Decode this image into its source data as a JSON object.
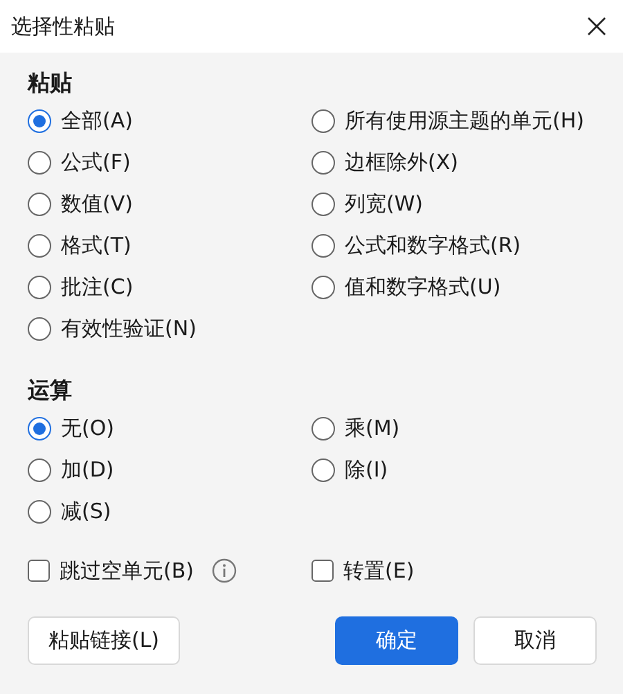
{
  "window": {
    "title": "选择性粘贴"
  },
  "sections": [
    {
      "heading": "粘贴",
      "options": [
        {
          "label": "全部(A)",
          "selected": true
        },
        {
          "label": "所有使用源主题的单元(H)",
          "selected": false
        },
        {
          "label": "公式(F)",
          "selected": false
        },
        {
          "label": "边框除外(X)",
          "selected": false
        },
        {
          "label": "数值(V)",
          "selected": false
        },
        {
          "label": "列宽(W)",
          "selected": false
        },
        {
          "label": "格式(T)",
          "selected": false
        },
        {
          "label": "公式和数字格式(R)",
          "selected": false
        },
        {
          "label": "批注(C)",
          "selected": false
        },
        {
          "label": "值和数字格式(U)",
          "selected": false
        },
        {
          "label": "有效性验证(N)",
          "selected": false
        }
      ]
    },
    {
      "heading": "运算",
      "options": [
        {
          "label": "无(O)",
          "selected": true
        },
        {
          "label": "乘(M)",
          "selected": false
        },
        {
          "label": "加(D)",
          "selected": false
        },
        {
          "label": "除(I)",
          "selected": false
        },
        {
          "label": "减(S)",
          "selected": false
        }
      ]
    }
  ],
  "checkboxes": [
    {
      "label": "跳过空单元(B)",
      "checked": false,
      "info": true
    },
    {
      "label": "转置(E)",
      "checked": false,
      "info": false
    }
  ],
  "buttons": [
    {
      "label": "粘贴链接(L)",
      "kind": "secondary"
    },
    {
      "label": "确定",
      "kind": "primary"
    },
    {
      "label": "取消",
      "kind": "secondary"
    }
  ]
}
